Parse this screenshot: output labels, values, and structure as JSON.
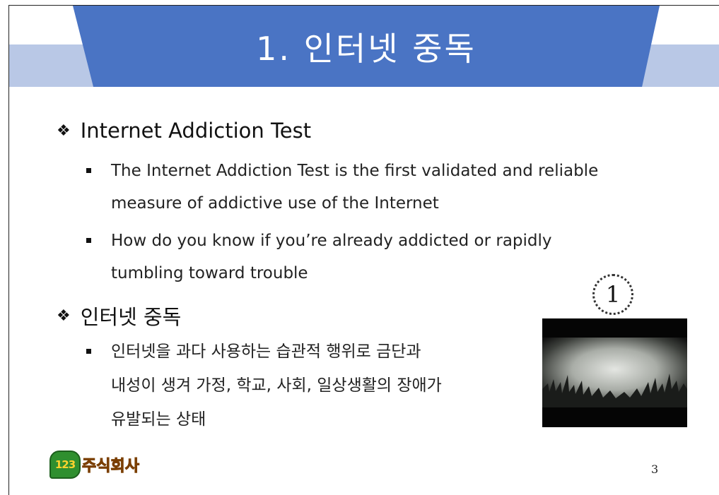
{
  "slide": {
    "title": "1. 인터넷 중독",
    "page_number": "3",
    "accent_color": "#4a74c4",
    "band_color": "#b9c8e6"
  },
  "section1": {
    "marker": "❖",
    "heading": "Internet Addiction Test",
    "bullets": [
      {
        "line1": "The Internet Addiction Test is the first validated and reliable",
        "line2": "measure of addictive use of the Internet"
      },
      {
        "line1": "How do you know if you’re already addicted or rapidly",
        "line2": "tumbling toward trouble"
      }
    ]
  },
  "section2": {
    "marker": "❖",
    "heading": "인터넷 중독",
    "bullets": [
      {
        "line1": "인터넷을 과다 사용하는 습관적 행위로 금단과",
        "line2": "내성이 생겨 가정, 학교, 사회, 일상생활의 장애가",
        "line3": "유발되는 상태"
      }
    ]
  },
  "media": {
    "badge": "1",
    "thumbnail_icon": "video-thumbnail-grass"
  },
  "logo": {
    "badge_text": "123",
    "text": "주식회사"
  }
}
